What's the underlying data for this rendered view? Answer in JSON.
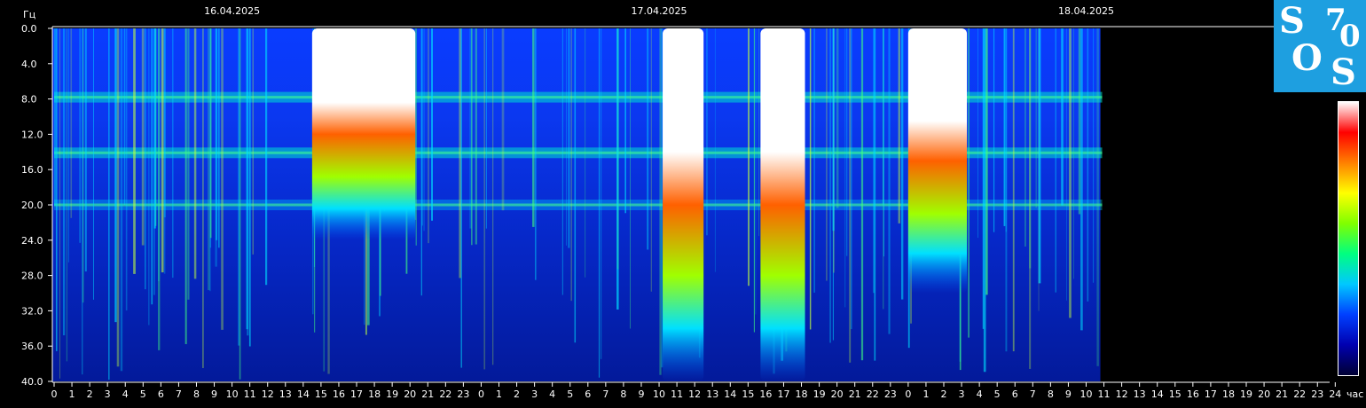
{
  "chart_data": {
    "type": "heatmap",
    "ylabel": "Гц",
    "xlabel": "час",
    "y_ticks": [
      "0.0",
      "4.0",
      "8.0",
      "12.0",
      "16.0",
      "20.0",
      "24.0",
      "28.0",
      "32.0",
      "36.0",
      "40.0"
    ],
    "ylim": [
      0,
      40
    ],
    "date_labels": [
      {
        "date": "16.04.2025",
        "hour_index": 10
      },
      {
        "date": "17.04.2025",
        "hour_index": 34
      },
      {
        "date": "18.04.2025",
        "hour_index": 58
      }
    ],
    "x_ticks": [
      "0",
      "1",
      "2",
      "3",
      "4",
      "5",
      "6",
      "7",
      "8",
      "9",
      "10",
      "11",
      "12",
      "13",
      "14",
      "15",
      "16",
      "17",
      "18",
      "19",
      "20",
      "21",
      "22",
      "23",
      "0",
      "1",
      "2",
      "3",
      "4",
      "5",
      "6",
      "7",
      "8",
      "9",
      "10",
      "11",
      "12",
      "13",
      "14",
      "15",
      "16",
      "17",
      "18",
      "19",
      "20",
      "21",
      "22",
      "23",
      "0",
      "1",
      "2",
      "3",
      "4",
      "5",
      "6",
      "7",
      "8",
      "9",
      "10",
      "11",
      "12",
      "13",
      "14",
      "15",
      "16",
      "17",
      "18",
      "19",
      "20",
      "21",
      "22",
      "23",
      "24"
    ],
    "data_end_hour_index": 58.9,
    "schumann_bands_hz": [
      7.8,
      14.1,
      20.0
    ],
    "bursts": [
      {
        "from": 14.5,
        "to": 20.3,
        "max_hz": 24
      },
      {
        "from": 34.2,
        "to": 36.5,
        "max_hz": 40
      },
      {
        "from": 39.7,
        "to": 42.2,
        "max_hz": 40
      },
      {
        "from": 48.0,
        "to": 51.3,
        "max_hz": 30
      }
    ],
    "colorscale": [
      "#000033",
      "#0000b0",
      "#0040ff",
      "#00c8ff",
      "#00ff80",
      "#80ff00",
      "#ffff00",
      "#ff8000",
      "#ff0000",
      "#ffffff"
    ]
  },
  "logo": {
    "letters": [
      "S",
      "7",
      "0",
      "O",
      "S"
    ],
    "color": "#1e9fe0"
  }
}
